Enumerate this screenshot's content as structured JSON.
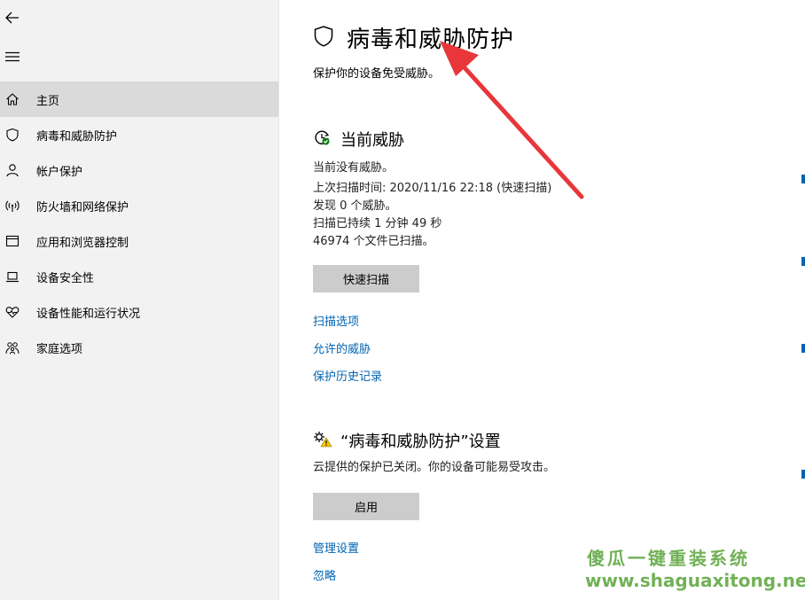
{
  "page": {
    "title": "病毒和威胁防护",
    "subtitle": "保护你的设备免受威胁。"
  },
  "sidebar": {
    "items": [
      {
        "label": "主页",
        "icon": "home-icon"
      },
      {
        "label": "病毒和威胁防护",
        "icon": "shield-icon"
      },
      {
        "label": "帐户保护",
        "icon": "person-icon"
      },
      {
        "label": "防火墙和网络保护",
        "icon": "wireless-icon"
      },
      {
        "label": "应用和浏览器控制",
        "icon": "browser-window-icon"
      },
      {
        "label": "设备安全性",
        "icon": "laptop-icon"
      },
      {
        "label": "设备性能和运行状况",
        "icon": "heart-icon"
      },
      {
        "label": "家庭选项",
        "icon": "family-icon"
      }
    ]
  },
  "threats": {
    "title": "当前威胁",
    "status": "当前没有威胁。",
    "last_scan": "上次扫描时间: 2020/11/16 22:18 (快速扫描)",
    "found": "发现 0 个威胁。",
    "duration": "扫描已持续 1 分钟 49 秒",
    "files": "46974 个文件已扫描。",
    "quick_scan_button": "快速扫描",
    "links": [
      "扫描选项",
      "允许的威胁",
      "保护历史记录"
    ]
  },
  "settings": {
    "title": "“病毒和威胁防护”设置",
    "status": "云提供的保护已关闭。你的设备可能易受攻击。",
    "enable_button": "启用",
    "links": [
      "管理设置",
      "忽略"
    ]
  },
  "watermark": {
    "cn": "傻瓜一键重装系统",
    "en": "www.shaguaxitong.net"
  },
  "colors": {
    "link": "#0063b1",
    "sidebar_bg": "#f2f2f2",
    "selected_bg": "#dadada",
    "button_bg": "#cccccc",
    "arrow": "#e8363a",
    "watermark": "#5aa43a"
  }
}
